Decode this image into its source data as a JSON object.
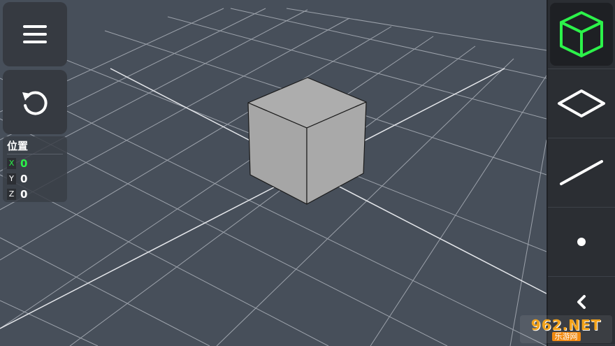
{
  "toolbar_left": {
    "menu_icon": "hamburger-menu-icon",
    "undo_icon": "undo-icon"
  },
  "position_panel": {
    "title": "位置",
    "x_label": "X",
    "x_value": "0",
    "y_label": "Y",
    "y_value": "0",
    "z_label": "Z",
    "z_value": "0"
  },
  "right_toolbar": {
    "items": [
      {
        "icon": "cube-icon",
        "selected": true
      },
      {
        "icon": "plane-icon",
        "selected": false
      },
      {
        "icon": "line-icon",
        "selected": false
      },
      {
        "icon": "point-icon",
        "selected": false
      },
      {
        "icon": "chevron-left-icon",
        "selected": false
      }
    ]
  },
  "watermark": {
    "brand": "962.NET",
    "sub": "乐游网"
  },
  "colors": {
    "background": "#474f5a",
    "grid": "#c8ccd2",
    "accent": "#2cf24a",
    "panel": "#363a41",
    "cube_face": "#a9a9a9"
  }
}
